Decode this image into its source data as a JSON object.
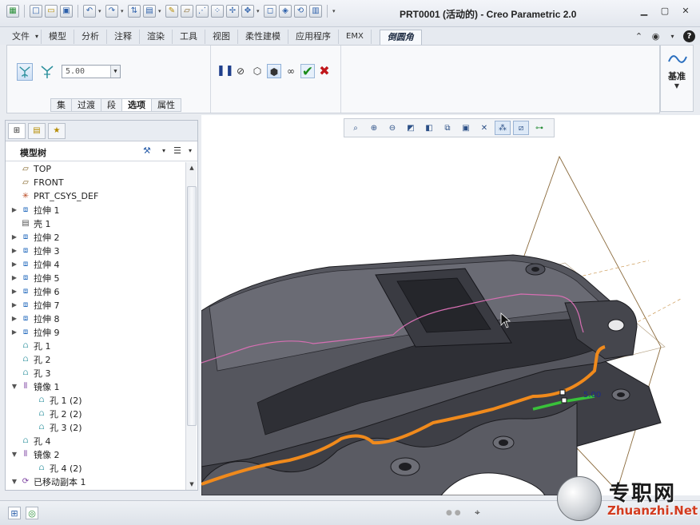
{
  "window": {
    "title": "PRT0001 (活动的) - Creo Parametric 2.0",
    "controls": [
      "minimize",
      "maximize",
      "close"
    ]
  },
  "quick_access": {
    "icons": [
      "app-icon",
      "new-icon",
      "open-icon",
      "save-icon",
      "undo-icon",
      "redo-icon",
      "regenerate-icon",
      "windows-icon",
      "sketch-icon",
      "datum-plane-icon",
      "datum-axis-icon",
      "datum-point-icon",
      "csys-icon",
      "move-icon",
      "box-icon",
      "display-icon",
      "rotate-icon",
      "customize-icon"
    ]
  },
  "ribbon": {
    "tabs": [
      {
        "label": "文件"
      },
      {
        "label": "模型"
      },
      {
        "label": "分析"
      },
      {
        "label": "注释"
      },
      {
        "label": "渲染"
      },
      {
        "label": "工具"
      },
      {
        "label": "视图"
      },
      {
        "label": "柔性建模"
      },
      {
        "label": "应用程序"
      },
      {
        "label": "EMX"
      }
    ],
    "active_tab": "倒圆角",
    "fillet": {
      "radius_value": "5.00",
      "subtabs": [
        {
          "label": "集"
        },
        {
          "label": "过渡"
        },
        {
          "label": "段"
        },
        {
          "label": "选项"
        },
        {
          "label": "属性"
        }
      ],
      "active_subtab": "选项"
    },
    "datum_group": {
      "label": "基准"
    }
  },
  "model_tree": {
    "title": "模型树",
    "items": [
      {
        "label": "TOP",
        "icon": "plane"
      },
      {
        "label": "FRONT",
        "icon": "plane"
      },
      {
        "label": "PRT_CSYS_DEF",
        "icon": "csys"
      },
      {
        "label": "拉伸 1",
        "icon": "extrude",
        "expandable": true
      },
      {
        "label": "壳 1",
        "icon": "shell"
      },
      {
        "label": "拉伸 2",
        "icon": "extrude",
        "expandable": true
      },
      {
        "label": "拉伸 3",
        "icon": "extrude",
        "expandable": true
      },
      {
        "label": "拉伸 4",
        "icon": "extrude",
        "expandable": true
      },
      {
        "label": "拉伸 5",
        "icon": "extrude",
        "expandable": true
      },
      {
        "label": "拉伸 6",
        "icon": "extrude",
        "expandable": true
      },
      {
        "label": "拉伸 7",
        "icon": "extrude",
        "expandable": true
      },
      {
        "label": "拉伸 8",
        "icon": "extrude",
        "expandable": true
      },
      {
        "label": "拉伸 9",
        "icon": "extrude",
        "expandable": true
      },
      {
        "label": "孔 1",
        "icon": "hole"
      },
      {
        "label": "孔 2",
        "icon": "hole"
      },
      {
        "label": "孔 3",
        "icon": "hole"
      },
      {
        "label": "镜像 1",
        "icon": "mirror",
        "expanded": true
      },
      {
        "label": "孔 1 (2)",
        "icon": "hole",
        "level": 2
      },
      {
        "label": "孔 2 (2)",
        "icon": "hole",
        "level": 2
      },
      {
        "label": "孔 3 (2)",
        "icon": "hole",
        "level": 2
      },
      {
        "label": "孔 4",
        "icon": "hole"
      },
      {
        "label": "镜像 2",
        "icon": "mirror",
        "expanded": true
      },
      {
        "label": "孔 4 (2)",
        "icon": "hole",
        "level": 2
      },
      {
        "label": "已移动副本 1",
        "icon": "move",
        "expanded": true
      }
    ]
  },
  "viewport": {
    "dimension_label": "5.00",
    "toolbar_icons": [
      "refit-icon",
      "zoom-in-icon",
      "zoom-out-icon",
      "repaint-icon",
      "display-style-icon",
      "saved-views-icon",
      "view-manager-icon",
      "perspective-icon",
      "datum-display-icon",
      "plane-display-icon",
      "axis-display-icon",
      "point-display-icon",
      "csys-display-icon"
    ]
  },
  "watermark": {
    "cn": "专职网",
    "en": "Zhuanzhi.Net"
  },
  "colors": {
    "selection_orange": "#f08a1c",
    "selection_green": "#39c13a",
    "part_body": "#4a4b52",
    "datum_brown": "#8a6a3c",
    "curve_pink": "#d76fb3"
  }
}
